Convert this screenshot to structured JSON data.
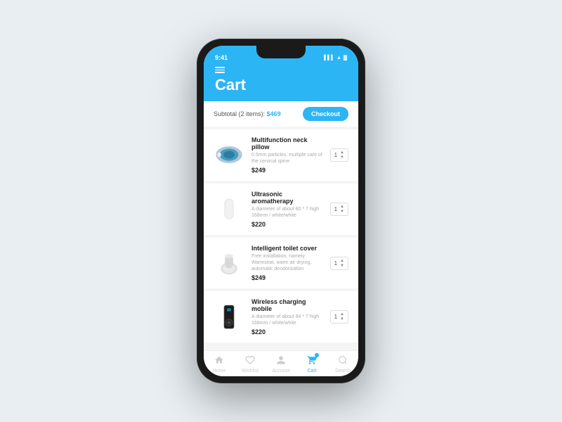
{
  "app": {
    "title": "Cart"
  },
  "status_bar": {
    "time": "9:41",
    "signal": "▌▌▌",
    "wifi": "WiFi",
    "battery": "⬛"
  },
  "header": {
    "title": "Cart",
    "menu_icon": "≡"
  },
  "subtotal": {
    "label": "Subtotal (2 items):",
    "price": "$469",
    "checkout_label": "Checkout"
  },
  "cart_items": [
    {
      "id": 1,
      "name": "Multifunction neck pillow",
      "description": "0.5mm particles, multiple care of the cervical spine",
      "price": "$249",
      "qty": "1",
      "image_type": "neck-pillow"
    },
    {
      "id": 2,
      "name": "Ultrasonic aromatherapy",
      "description": "A diameter of about 80 * 7 high 168mm / white/white",
      "price": "$220",
      "qty": "1",
      "image_type": "aromatherapy"
    },
    {
      "id": 3,
      "name": "Intelligent toilet cover",
      "description": "Free installation, namely Warmseat, warm air drying, automatic deodorization",
      "price": "$249",
      "qty": "1",
      "image_type": "toilet"
    },
    {
      "id": 4,
      "name": "Wireless charging mobile",
      "description": "A diameter of about 84 * 7 high 168mm / white/white",
      "price": "$220",
      "qty": "1",
      "image_type": "charger"
    }
  ],
  "bottom_nav": {
    "items": [
      {
        "id": "home",
        "label": "Home",
        "active": false,
        "icon": "🏠"
      },
      {
        "id": "wishlist",
        "label": "Wishlist",
        "active": false,
        "icon": "♡"
      },
      {
        "id": "account",
        "label": "Account",
        "active": false,
        "icon": "👤"
      },
      {
        "id": "cart",
        "label": "Cart",
        "active": true,
        "icon": "🛒"
      },
      {
        "id": "search",
        "label": "Search",
        "active": false,
        "icon": "🔍"
      }
    ]
  }
}
